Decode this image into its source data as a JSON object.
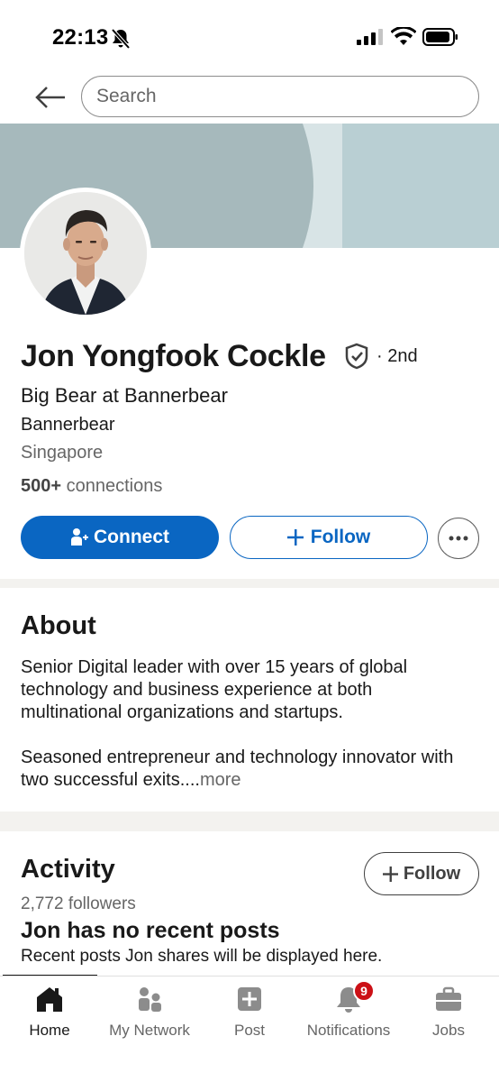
{
  "status_bar": {
    "time": "22:13"
  },
  "header": {
    "search_placeholder": "Search"
  },
  "profile": {
    "name": "Jon Yongfook Cockle",
    "degree": "· 2nd",
    "headline": "Big Bear at Bannerbear",
    "company": "Bannerbear",
    "location": "Singapore",
    "connections_count": "500+",
    "connections_label": "connections"
  },
  "actions": {
    "connect_label": "Connect",
    "follow_label": "Follow"
  },
  "about": {
    "title": "About",
    "paragraph1": "Senior Digital leader with over 15 years of global technology and business experience at both multinational organizations and startups.",
    "paragraph2": "Seasoned entrepreneur and technology innovator with two successful exits....",
    "more_label": "more"
  },
  "activity": {
    "title": "Activity",
    "follow_label": "Follow",
    "followers": "2,772 followers",
    "empty_title": "Jon has no recent posts",
    "empty_subtitle": "Recent posts Jon shares will be displayed here."
  },
  "bottom_nav": {
    "items": [
      {
        "label": "Home",
        "icon": "home-icon",
        "active": true
      },
      {
        "label": "My Network",
        "icon": "network-icon"
      },
      {
        "label": "Post",
        "icon": "post-icon"
      },
      {
        "label": "Notifications",
        "icon": "bell-icon",
        "badge": "9"
      },
      {
        "label": "Jobs",
        "icon": "briefcase-icon"
      }
    ]
  },
  "colors": {
    "primary": "#0a66c2",
    "banner": "#b9cfd3",
    "badge": "#cc1016",
    "text": "#191919",
    "muted": "#666666"
  }
}
